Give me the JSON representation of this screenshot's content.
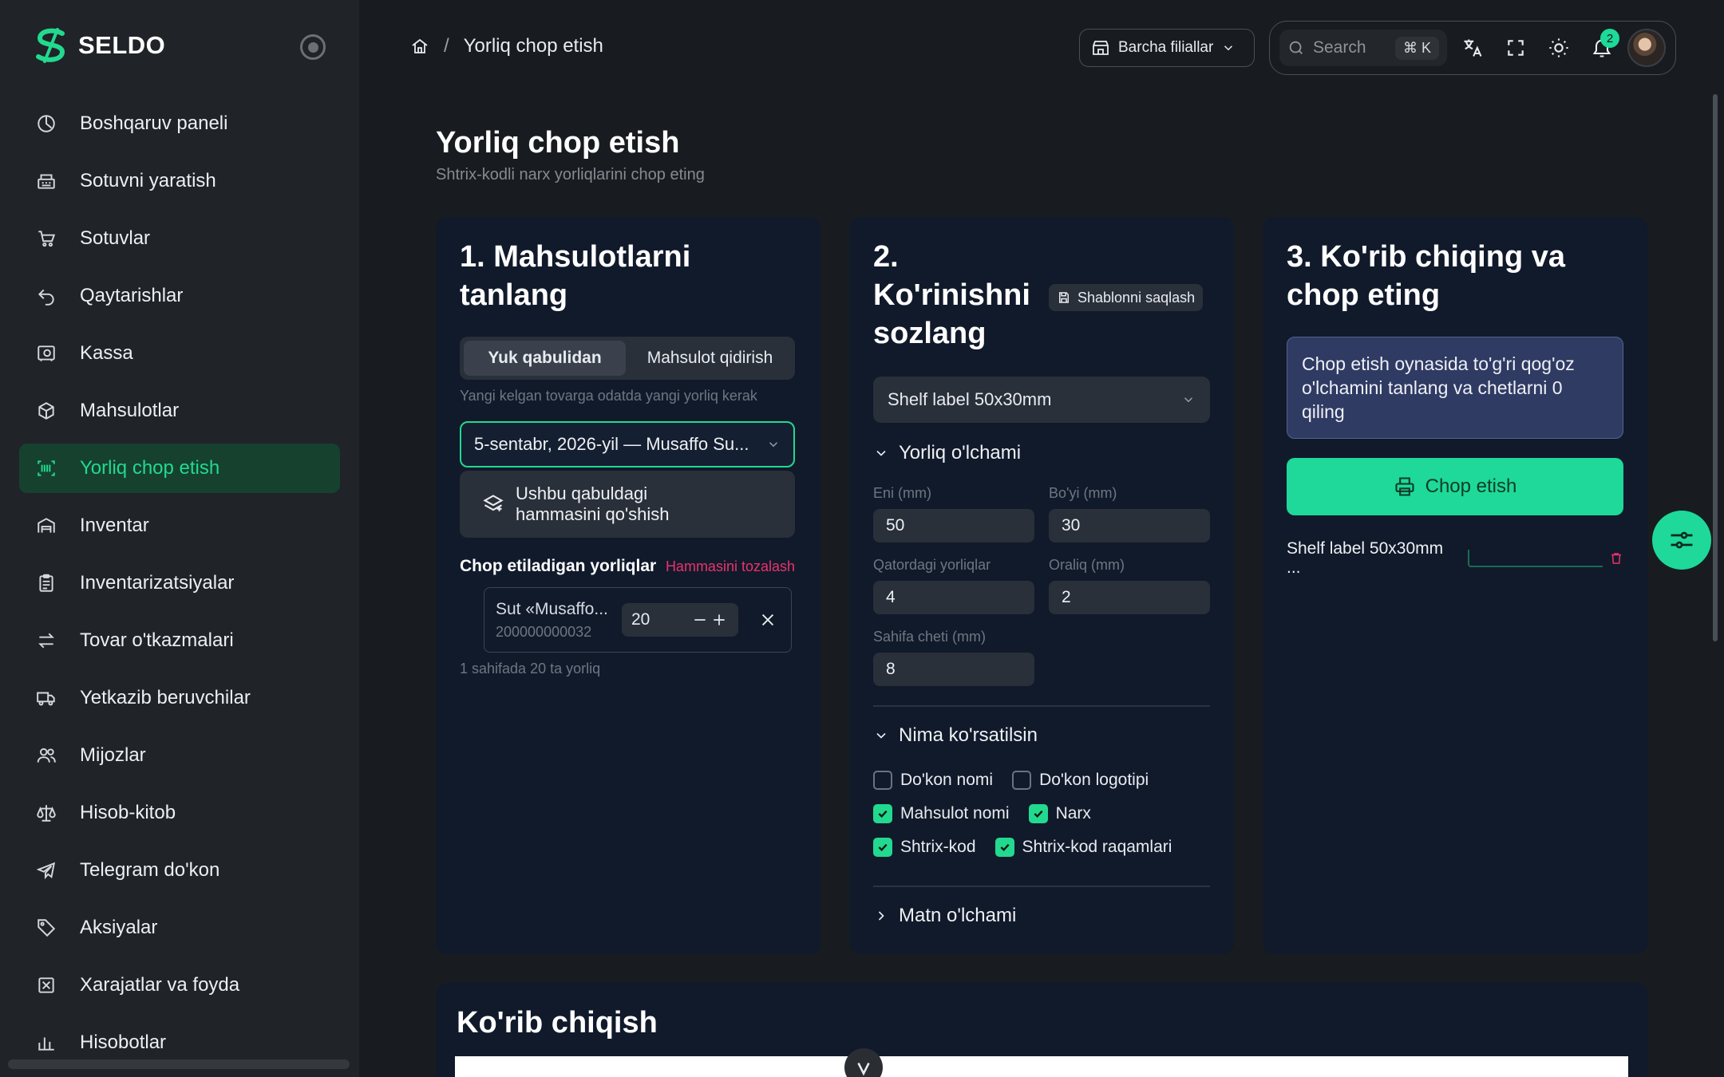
{
  "brand": {
    "name": "SELDO",
    "accent": "#22d98f"
  },
  "sidebar": {
    "items": [
      {
        "label": "Boshqaruv paneli",
        "icon": "dashboard-icon"
      },
      {
        "label": "Sotuvni yaratish",
        "icon": "cash-register-icon"
      },
      {
        "label": "Sotuvlar",
        "icon": "cart-icon"
      },
      {
        "label": "Qaytarishlar",
        "icon": "return-icon"
      },
      {
        "label": "Kassa",
        "icon": "safe-icon"
      },
      {
        "label": "Mahsulotlar",
        "icon": "box-icon"
      },
      {
        "label": "Yorliq chop etish",
        "icon": "barcode-icon",
        "active": true
      },
      {
        "label": "Inventar",
        "icon": "warehouse-icon"
      },
      {
        "label": "Inventarizatsiyalar",
        "icon": "clipboard-icon"
      },
      {
        "label": "Tovar o'tkazmalari",
        "icon": "transfer-icon"
      },
      {
        "label": "Yetkazib beruvchilar",
        "icon": "truck-icon"
      },
      {
        "label": "Mijozlar",
        "icon": "users-icon"
      },
      {
        "label": "Hisob-kitob",
        "icon": "scale-icon"
      },
      {
        "label": "Telegram do'kon",
        "icon": "telegram-icon"
      },
      {
        "label": "Aksiyalar",
        "icon": "tag-icon"
      },
      {
        "label": "Xarajatlar va foyda",
        "icon": "expense-icon"
      },
      {
        "label": "Hisobotlar",
        "icon": "chart-icon"
      }
    ]
  },
  "header": {
    "breadcrumb_current": "Yorliq chop etish",
    "branch": "Barcha filiallar",
    "search_placeholder": "Search",
    "search_shortcut": "⌘ K",
    "notifications_count": "2"
  },
  "page": {
    "title": "Yorliq chop etish",
    "subtitle": "Shtrix-kodli narx yorliqlarini chop eting"
  },
  "step1": {
    "title": "1. Mahsulotlarni tanlang",
    "tabs": [
      "Yuk qabulidan",
      "Mahsulot qidirish"
    ],
    "hint": "Yangi kelgan tovarga odatda yangi yorliq kerak",
    "receipt_selected": "5-sentabr, 2026-yil — Musaffo Su...",
    "add_all": "Ushbu qabuldagi hammasini qo'shish",
    "labels_title": "Chop etiladigan yorliqlar",
    "clear_all": "Hammasini tozalash",
    "item_name": "Sut «Musaffo...",
    "item_code": "200000000032",
    "item_qty": "20",
    "summary": "1 sahifada 20 ta yorliq"
  },
  "step2": {
    "title": "2. Ko'rinishni sozlang",
    "save_template": "Shablonni saqlash",
    "template": "Shelf label 50x30mm",
    "size_section": "Yorliq o'lchami",
    "fields": {
      "width_label": "Eni (mm)",
      "width": "50",
      "height_label": "Bo'yi (mm)",
      "height": "30",
      "per_row_label": "Qatordagi yorliqlar",
      "per_row": "4",
      "gap_label": "Oraliq (mm)",
      "gap": "2",
      "margin_label": "Sahifa cheti (mm)",
      "margin": "8"
    },
    "show_section": "Nima ko'rsatilsin",
    "checks": [
      {
        "label": "Do'kon nomi",
        "checked": false
      },
      {
        "label": "Do'kon logotipi",
        "checked": false
      },
      {
        "label": "Mahsulot nomi",
        "checked": true
      },
      {
        "label": "Narx",
        "checked": true
      },
      {
        "label": "Shtrix-kod",
        "checked": true
      },
      {
        "label": "Shtrix-kod raqamlari",
        "checked": true
      }
    ],
    "text_size_section": "Matn o'lchami"
  },
  "step3": {
    "title": "3. Ko'rib chiqing va chop eting",
    "info": "Chop etish oynasida to'g'ri qog'oz o'lchamini tanlang va chetlarni 0 qiling",
    "print_button": "Chop etish",
    "job_label": "Shelf label 50x30mm ..."
  },
  "preview": {
    "title": "Ko'rib chiqish"
  }
}
